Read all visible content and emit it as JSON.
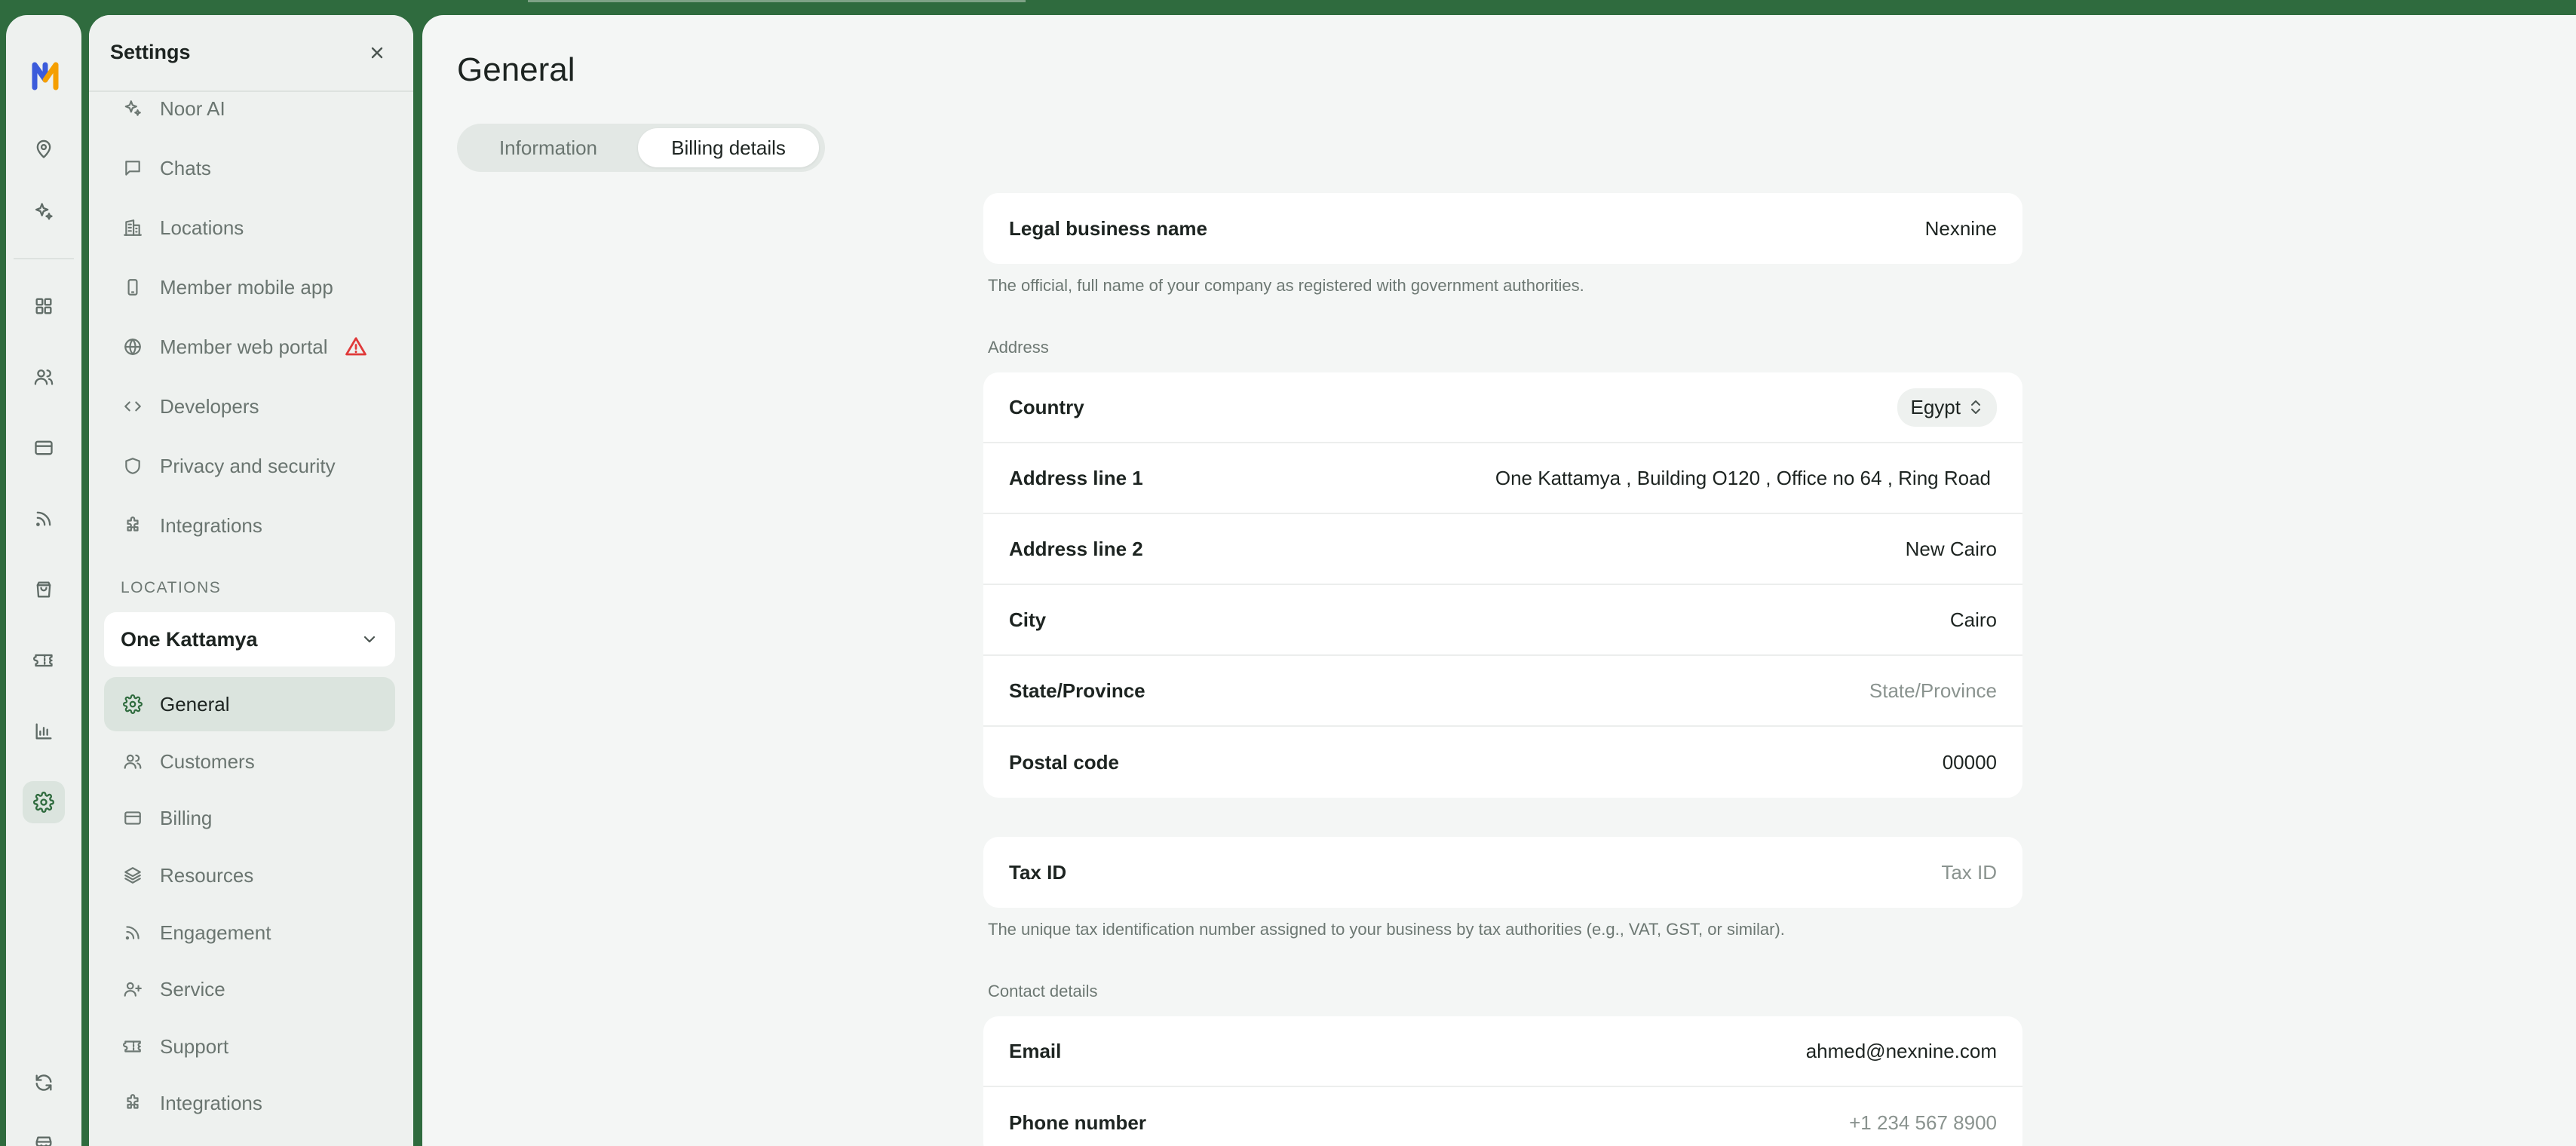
{
  "settings": {
    "title": "Settings",
    "org_items": [
      {
        "label": "Noor AI",
        "icon": "sparkles-icon"
      },
      {
        "label": "Chats",
        "icon": "chat-icon"
      },
      {
        "label": "Locations",
        "icon": "building-icon"
      },
      {
        "label": "Member mobile app",
        "icon": "phone-icon"
      },
      {
        "label": "Member web portal",
        "icon": "globe-icon",
        "warning": true
      },
      {
        "label": "Developers",
        "icon": "code-icon"
      },
      {
        "label": "Privacy and security",
        "icon": "shield-icon"
      },
      {
        "label": "Integrations",
        "icon": "puzzle-icon"
      }
    ],
    "locations_label": "LOCATIONS",
    "location_selected": "One Kattamya",
    "location_items": [
      {
        "label": "General",
        "icon": "gear-icon",
        "active": true
      },
      {
        "label": "Customers",
        "icon": "users-icon"
      },
      {
        "label": "Billing",
        "icon": "credit-card-icon"
      },
      {
        "label": "Resources",
        "icon": "layers-icon"
      },
      {
        "label": "Engagement",
        "icon": "rss-icon"
      },
      {
        "label": "Service",
        "icon": "user-plus-icon"
      },
      {
        "label": "Support",
        "icon": "ticket-icon"
      },
      {
        "label": "Integrations",
        "icon": "puzzle-icon"
      }
    ]
  },
  "main": {
    "title": "General",
    "tabs": [
      {
        "label": "Information",
        "active": false
      },
      {
        "label": "Billing details",
        "active": true
      }
    ],
    "legal": {
      "label": "Legal business name",
      "value": "Nexnine",
      "help": "The official, full name of your company as registered with government authorities."
    },
    "address": {
      "section": "Address",
      "country_label": "Country",
      "country_value": "Egypt",
      "line1_label": "Address line 1",
      "line1_value": "One Kattamya , Building O120 , Office no 64 , Ring Road",
      "line2_label": "Address line 2",
      "line2_value": "New Cairo",
      "city_label": "City",
      "city_value": "Cairo",
      "state_label": "State/Province",
      "state_placeholder": "State/Province",
      "postal_label": "Postal code",
      "postal_value": "00000"
    },
    "tax": {
      "label": "Tax ID",
      "placeholder": "Tax ID",
      "help": "The unique tax identification number assigned to your business by tax authorities (e.g., VAT, GST, or similar)."
    },
    "contact": {
      "section": "Contact details",
      "email_label": "Email",
      "email_value": "ahmed@nexnine.com",
      "phone_label": "Phone number",
      "phone_placeholder": "+1 234 567 8900"
    }
  },
  "colors": {
    "brand": "#2f6b3e",
    "warning": "#e03a3a"
  }
}
